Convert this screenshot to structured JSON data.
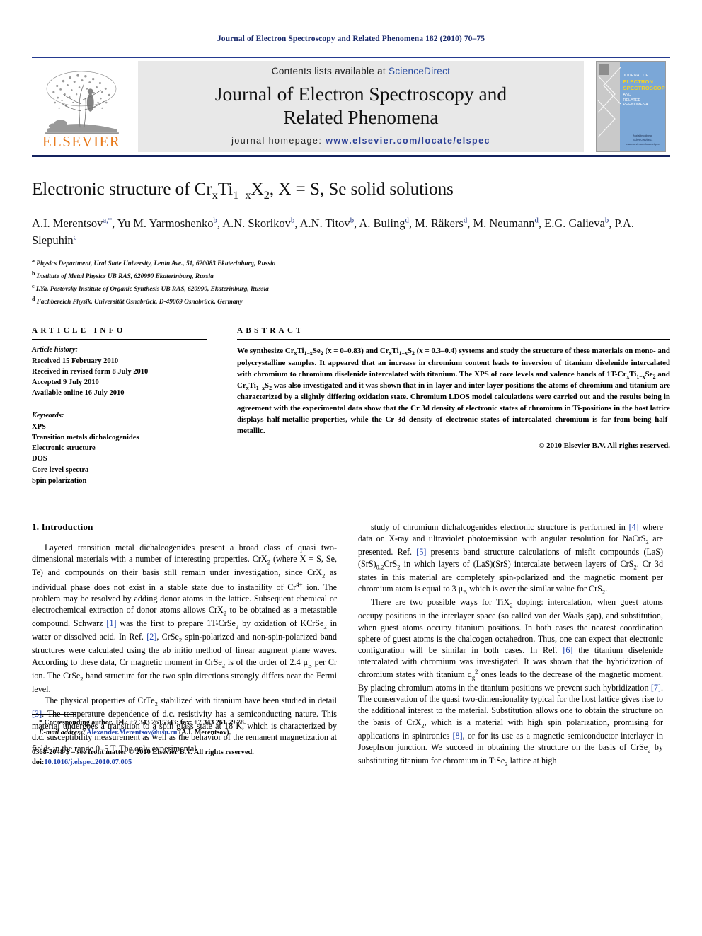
{
  "running_head": "Journal of Electron Spectroscopy and Related Phenomena 182 (2010) 70–75",
  "masthead": {
    "contents_prefix": "Contents lists available at ",
    "sciencedirect": "ScienceDirect",
    "journal_title_line1": "Journal of Electron Spectroscopy and",
    "journal_title_line2": "Related Phenomena",
    "homepage_label": "journal homepage:",
    "homepage_url": "www.elsevier.com/locate/elspec",
    "publisher": "ELSEVIER",
    "cover": {
      "line1": "JOURNAL OF",
      "line2a": "ELECTRON",
      "line2b": "SPECTROSCOPY",
      "line3a": "AND",
      "line3b": "RELATED PHENOMENA",
      "bottom1": "Available online at",
      "bottom2": "ScienceDirect",
      "bottom3": "www.elsevier.com/locate/elspec"
    }
  },
  "article": {
    "title_prefix": "Electronic structure of Cr",
    "title_sub1": "x",
    "title_mid1": "Ti",
    "title_sub2": "1−x",
    "title_mid2": "X",
    "title_sub3": "2",
    "title_suffix": ", X = S, Se solid solutions",
    "authors": [
      {
        "name": "A.I. Merentsov",
        "marks": "a,*"
      },
      {
        "name": "Yu M. Yarmoshenko",
        "marks": "b"
      },
      {
        "name": "A.N. Skorikov",
        "marks": "b"
      },
      {
        "name": "A.N. Titov",
        "marks": "b"
      },
      {
        "name": "A. Buling",
        "marks": "d"
      },
      {
        "name": "M. Räkers",
        "marks": "d"
      },
      {
        "name": "M. Neumann",
        "marks": "d"
      },
      {
        "name": "E.G. Galieva",
        "marks": "b"
      },
      {
        "name": "P.A. Slepuhin",
        "marks": "c"
      }
    ],
    "affiliations": [
      {
        "mark": "a",
        "text": "Physics Department, Ural State University, Lenin Ave., 51, 620083 Ekaterinburg, Russia"
      },
      {
        "mark": "b",
        "text": "Institute of Metal Physics UB RAS, 620990 Ekaterinburg, Russia"
      },
      {
        "mark": "c",
        "text": "I.Ya. Postovsky Institute of Organic Synthesis UB RAS, 620990, Ekaterinburg, Russia"
      },
      {
        "mark": "d",
        "text": "Fachbereich Physik, Universität Osnabrück, D-49069 Osnabrück, Germany"
      }
    ]
  },
  "info": {
    "heading": "ARTICLE INFO",
    "history_label": "Article history:",
    "history": [
      "Received 15 February 2010",
      "Received in revised form 8 July 2010",
      "Accepted 9 July 2010",
      "Available online 16 July 2010"
    ],
    "keywords_label": "Keywords:",
    "keywords": [
      "XPS",
      "Transition metals dichalcogenides",
      "Electronic structure",
      "DOS",
      "Core level spectra",
      "Spin polarization"
    ]
  },
  "abstract": {
    "heading": "ABSTRACT",
    "text": "We synthesize CrxTi1−xSe2 (x = 0–0.83) and CrxTi1−xS2 (x = 0.3–0.4) systems and study the structure of these materials on mono- and polycrystalline samples. It appeared that an increase in chromium content leads to inversion of titanium diselenide intercalated with chromium to chromium diselenide intercalated with titanium. The XPS of core levels and valence bands of 1T-CrxTi1−xSe2 and CrxTi1−xS2 was also investigated and it was shown that in in-layer and inter-layer positions the atoms of chromium and titanium are characterized by a slightly differing oxidation state. Chromium LDOS model calculations were carried out and the results being in agreement with the experimental data show that the Cr 3d density of electronic states of chromium in Ti-positions in the host lattice displays half-metallic properties, while the Cr 3d density of electronic states of intercalated chromium is far from being half-metallic.",
    "copyright": "© 2010 Elsevier B.V. All rights reserved."
  },
  "body": {
    "section_title": "1. Introduction",
    "left_paragraphs": [
      "Layered transition metal dichalcogenides present a broad class of quasi two-dimensional materials with a number of interesting properties. CrX2 (where X = S, Se, Te) and compounds on their basis still remain under investigation, since CrX2 as individual phase does not exist in a stable state due to instability of Cr4+ ion. The problem may be resolved by adding donor atoms in the lattice. Subsequent chemical or electrochemical extraction of donor atoms allows CrX2 to be obtained as a metastable compound. Schwarz [1] was the first to prepare 1T-CrSe2 by oxidation of KCrSe2 in water or dissolved acid. In Ref. [2], CrSe2 spin-polarized and non-spin-polarized band structures were calculated using the ab initio method of linear augment plane waves. According to these data, Cr magnetic moment in CrSe2 is of the order of 2.4 μB per Cr ion. The CrSe2 band structure for the two spin directions strongly differs near the Fermi level.",
      "The physical properties of CrTe2 stabilized with titanium have been studied in detail [3]. The temperature dependence of d.c. resistivity has a semiconducting nature. This material undergoes a transition to a spin glass state at 18 K, which is characterized by d.c. susceptibility measurement as well as the behavior of the remanent magnetization at fields in the range 0–5 T. The only experimental"
    ],
    "right_paragraphs": [
      "study of chromium dichalcogenides electronic structure is performed in [4] where data on X-ray and ultraviolet photoemission with angular resolution for NaCrS2 are presented. Ref. [5] presents band structure calculations of misfit compounds (LaS)(SrS)0.2CrS2 in which layers of (LaS)(SrS) intercalate between layers of CrS2. Cr 3d states in this material are completely spin-polarized and the magnetic moment per chromium atom is equal to 3 μB which is over the similar value for CrS2.",
      "There are two possible ways for TiX2 doping: intercalation, when guest atoms occupy positions in the interlayer space (so called van der Waals gap), and substitution, when guest atoms occupy titanium positions. In both cases the nearest coordination sphere of guest atoms is the chalcogen octahedron. Thus, one can expect that electronic configuration will be similar in both cases. In Ref. [6] the titanium diselenide intercalated with chromium was investigated. It was shown that the hybridization of chromium states with titanium dg2 ones leads to the decrease of the magnetic moment. By placing chromium atoms in the titanium positions we prevent such hybridization [7]. The conservation of the quasi two-dimensionality typical for the host lattice gives rise to the additional interest to the material. Substitution allows one to obtain the structure on the basis of CrX2, which is a material with high spin polarization, promising for applications in spintronics [8], or for its use as a magnetic semiconductor interlayer in Josephson junction. We succeed in obtaining the structure on the basis of CrSe2 by substituting titanium for chromium in TiSe2 lattice at high"
    ]
  },
  "footer": {
    "corresponding": "* Corresponding author. Tel.: +7 343 2615343; fax: +7 343 261 59 78.",
    "email_label": "E-mail address:",
    "email": "Alexander.Merentsov@usu.ru",
    "email_suffix": "(A.I. Merentsov).",
    "issn_line": "0368-2048/$ – see front matter © 2010 Elsevier B.V. All rights reserved.",
    "doi_label": "doi:",
    "doi": "10.1016/j.elspec.2010.07.005"
  },
  "colors": {
    "header_navy": "#1a2a6c",
    "link_blue": "#1b3ea8",
    "elsevier_orange": "#e87b1e",
    "cover_blue": "#7ba7d7",
    "cover_yellow": "#f2d128"
  }
}
